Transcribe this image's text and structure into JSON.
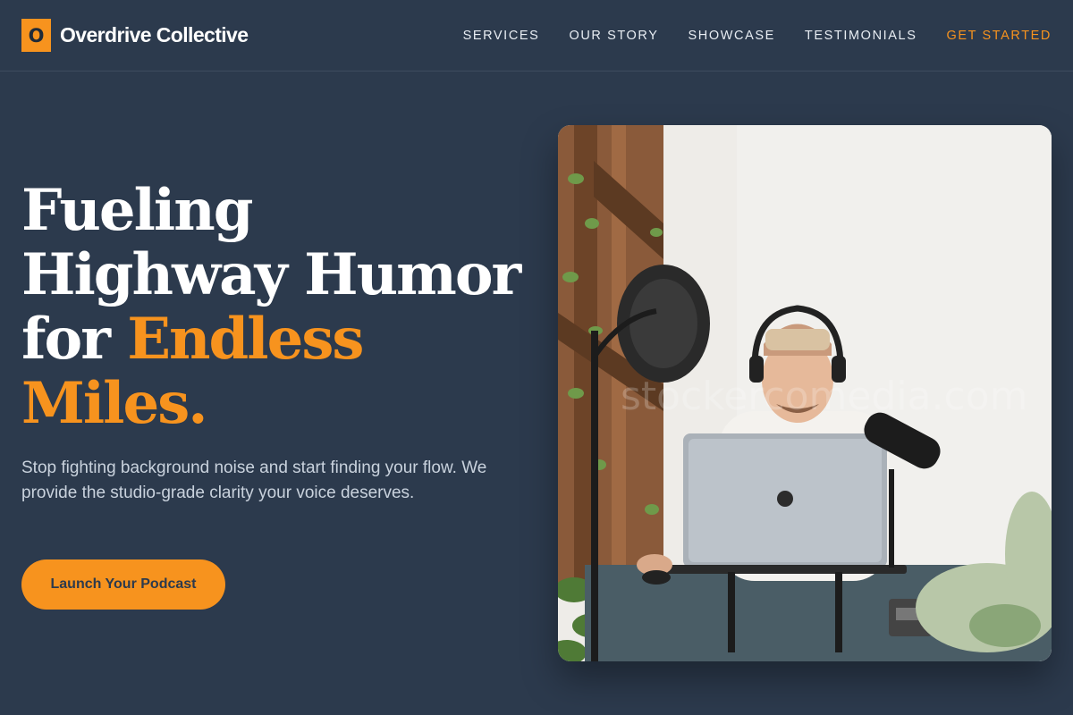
{
  "brand": {
    "mark": "O",
    "name": "Overdrive Collective"
  },
  "nav": {
    "items": [
      "SERVICES",
      "OUR STORY",
      "SHOWCASE",
      "TESTIMONIALS"
    ],
    "cta": "GET STARTED"
  },
  "hero": {
    "title_line1": "Fueling",
    "title_line2": "Highway Humor",
    "title_line3_plain": "for ",
    "title_line3_accent": "Endless",
    "title_line4_accent": "Miles.",
    "subtitle": "Stop fighting background noise and start finding your flow. We provide the studio-grade clarity your voice deserves.",
    "button": "Launch Your Podcast"
  },
  "colors": {
    "background": "#2c3a4d",
    "accent": "#f7931e",
    "text": "#ffffff",
    "muted_text": "#c9d2dd"
  },
  "image": {
    "watermark": "stockercomedia.com"
  }
}
